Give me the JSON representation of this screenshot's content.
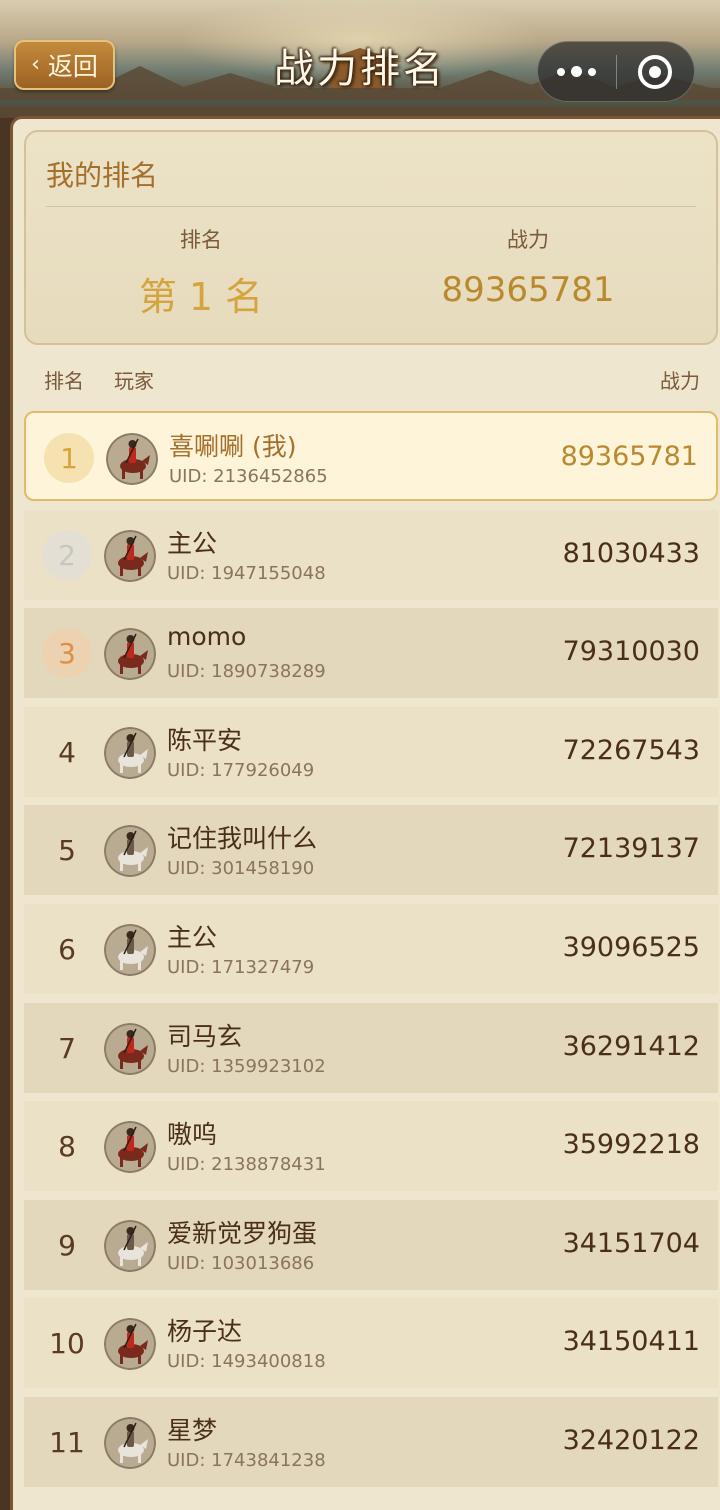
{
  "header": {
    "back_label": "返回",
    "back_icon": "chevron-left-icon",
    "title": "战力排名",
    "menu_icon": "more-dots-icon",
    "close_icon": "target-circle-icon"
  },
  "my_rank": {
    "title": "我的排名",
    "rank_label": "排名",
    "rank_value": "第 1 名",
    "power_label": "战力",
    "power_value": "89365781"
  },
  "list_header": {
    "rank": "排名",
    "player": "玩家",
    "power": "战力"
  },
  "rows": [
    {
      "rank": "1",
      "name": "喜唰唰 (我)",
      "uid": "UID: 2136452865",
      "power": "89365781",
      "avatar": "red"
    },
    {
      "rank": "2",
      "name": "主公",
      "uid": "UID: 1947155048",
      "power": "81030433",
      "avatar": "red"
    },
    {
      "rank": "3",
      "name": "momo",
      "uid": "UID: 1890738289",
      "power": "79310030",
      "avatar": "red"
    },
    {
      "rank": "4",
      "name": "陈平安",
      "uid": "UID: 177926049",
      "power": "72267543",
      "avatar": "white"
    },
    {
      "rank": "5",
      "name": "记住我叫什么",
      "uid": "UID: 301458190",
      "power": "72139137",
      "avatar": "white"
    },
    {
      "rank": "6",
      "name": "主公",
      "uid": "UID: 171327479",
      "power": "39096525",
      "avatar": "white"
    },
    {
      "rank": "7",
      "name": "司马玄",
      "uid": "UID: 1359923102",
      "power": "36291412",
      "avatar": "red"
    },
    {
      "rank": "8",
      "name": "嗷呜",
      "uid": "UID: 2138878431",
      "power": "35992218",
      "avatar": "red"
    },
    {
      "rank": "9",
      "name": "爱新觉罗狗蛋",
      "uid": "UID: 103013686",
      "power": "34151704",
      "avatar": "white"
    },
    {
      "rank": "10",
      "name": "杨子达",
      "uid": "UID: 1493400818",
      "power": "34150411",
      "avatar": "red"
    },
    {
      "rank": "11",
      "name": "星梦",
      "uid": "UID: 1743841238",
      "power": "32420122",
      "avatar": "white"
    }
  ],
  "colors": {
    "gold": "#d6a43c",
    "panel_bg": "#efe6cf",
    "row_odd": "#ebe1c7",
    "row_even": "#e3d8bb",
    "highlight_bg": "#fdf4da"
  }
}
